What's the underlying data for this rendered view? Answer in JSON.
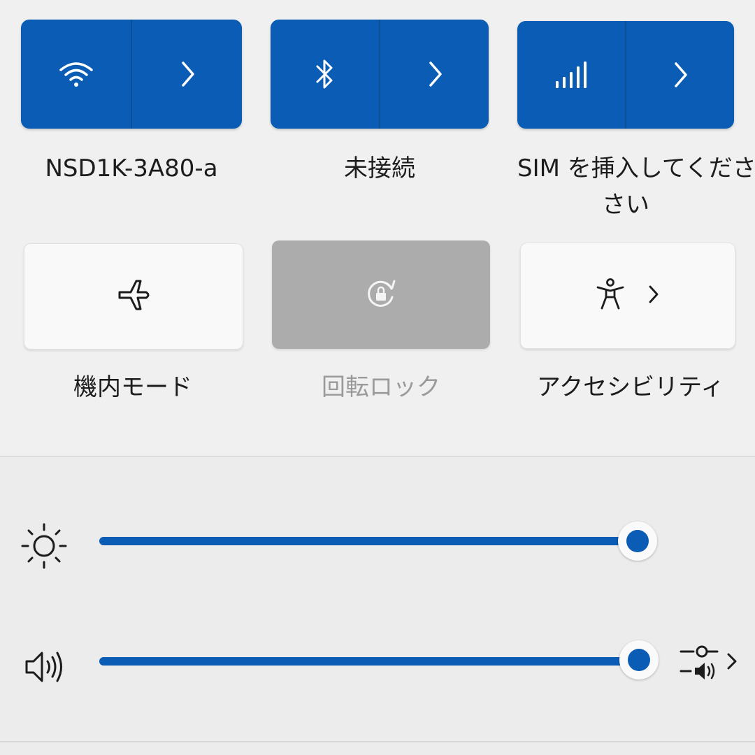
{
  "colors": {
    "accent": "#0a5cb4",
    "disabled_tile": "#acacac",
    "tile_light": "#f9f9f9"
  },
  "tiles": [
    {
      "label": "NSD1K-3A80-a",
      "icon": "wifi-icon",
      "expand_icon": "chevron-right-icon",
      "active": true
    },
    {
      "label": "未接続",
      "icon": "bluetooth-icon",
      "expand_icon": "chevron-right-icon",
      "active": true
    },
    {
      "label": "SIM を挿入してくださ\nさい",
      "label_line1": "SIM を挿入してくださ",
      "label_line2": "さい",
      "icon": "cellular-signal-icon",
      "expand_icon": "chevron-right-icon",
      "active": true
    },
    {
      "label": "機内モード",
      "icon": "airplane-icon",
      "active": false
    },
    {
      "label": "回転ロック",
      "icon": "rotation-lock-icon",
      "disabled": true
    },
    {
      "label": "アクセシビリティ",
      "icon": "accessibility-icon",
      "expand_icon": "chevron-right-icon",
      "active": false
    }
  ],
  "sliders": {
    "brightness": {
      "icon": "brightness-sun-icon",
      "value_percent": 100
    },
    "volume": {
      "icon": "speaker-volume-icon",
      "value_percent": 100,
      "output_icon": "audio-output-select-icon"
    }
  }
}
